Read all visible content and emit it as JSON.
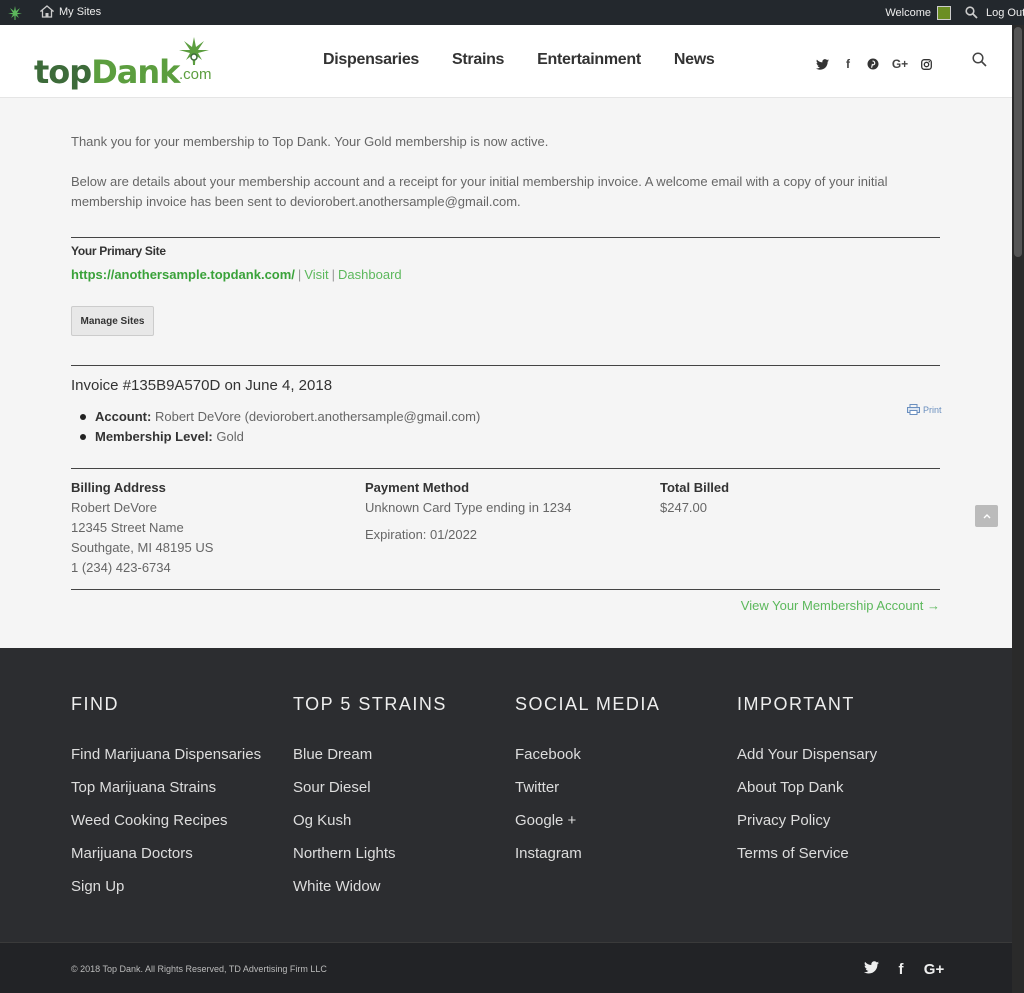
{
  "adminbar": {
    "my_sites": "My Sites",
    "welcome": "Welcome",
    "logout": "Log Out"
  },
  "header": {
    "logo_top": "top",
    "logo_dank": "Dank",
    "logo_com": ".com",
    "nav": [
      "Dispensaries",
      "Strains",
      "Entertainment",
      "News"
    ],
    "social": [
      "twitter-icon",
      "facebook-icon",
      "pinterest-icon",
      "google-plus-icon",
      "instagram-icon"
    ]
  },
  "main": {
    "thank_you": "Thank you for your membership to Top Dank. Your Gold membership is now active.",
    "details": "Below are details about your membership account and a receipt for your initial membership invoice. A welcome email with a copy of your initial membership invoice has been sent to deviorobert.anothersample@gmail.com.",
    "primary_site_heading": "Your Primary Site",
    "site_url": "https://anothersample.topdank.com/",
    "visit": "Visit",
    "dashboard": "Dashboard",
    "manage_sites": "Manage Sites",
    "invoice_title": "Invoice #135B9A570D on June 4, 2018",
    "account_label": "Account:",
    "account_value": "Robert DeVore (deviorobert.anothersample@gmail.com)",
    "level_label": "Membership Level:",
    "level_value": "Gold",
    "print": "Print",
    "billing": {
      "heading": "Billing Address",
      "name": "Robert DeVore",
      "street": "12345 Street Name",
      "city": "Southgate, MI 48195 US",
      "phone": "1 (234) 423-6734"
    },
    "payment": {
      "heading": "Payment Method",
      "card": "Unknown Card Type ending in 1234",
      "expiration": "Expiration: 01/2022"
    },
    "total": {
      "heading": "Total Billed",
      "amount": "$247.00"
    },
    "view_account": "View Your Membership Account →"
  },
  "footer": {
    "columns": [
      {
        "title": "FIND",
        "links": [
          "Find Marijuana Dispensaries",
          "Top Marijuana Strains",
          "Weed Cooking Recipes",
          "Marijuana Doctors",
          "Sign Up"
        ]
      },
      {
        "title": "TOP 5 STRAINS",
        "links": [
          "Blue Dream",
          "Sour Diesel",
          "Og Kush",
          "Northern Lights",
          "White Widow"
        ]
      },
      {
        "title": "SOCIAL MEDIA",
        "links": [
          "Facebook",
          "Twitter",
          "Google +",
          "Instagram"
        ]
      },
      {
        "title": "IMPORTANT",
        "links": [
          "Add Your Dispensary",
          "About Top Dank",
          "Privacy Policy",
          "Terms of Service"
        ]
      }
    ],
    "copyright": "© 2018 Top Dank. All Rights Reserved, TD Advertising Firm LLC"
  }
}
